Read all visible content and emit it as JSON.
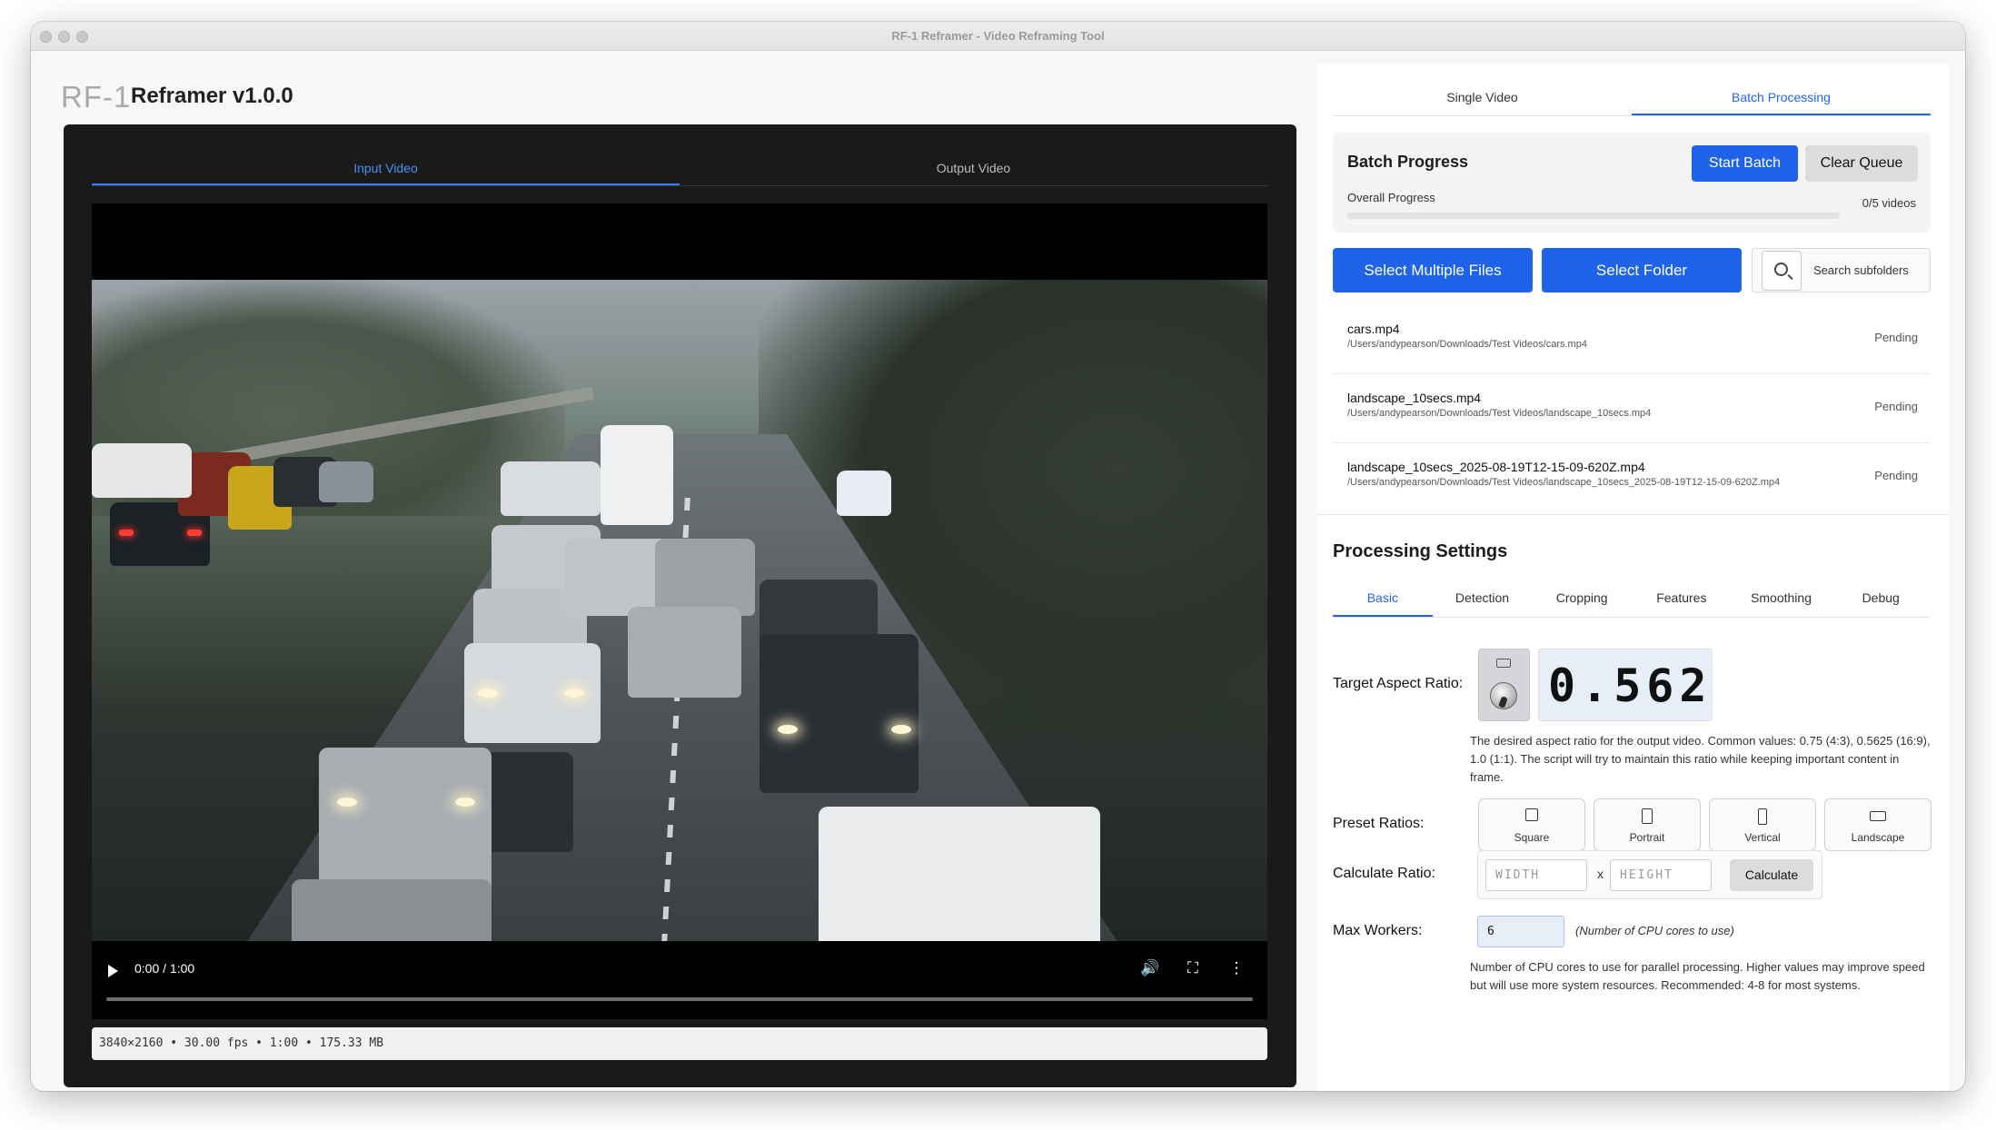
{
  "window": {
    "title": "RF-1 Reframer - Video Reframing Tool"
  },
  "app": {
    "logo": "RF-1",
    "title": "Reframer v1.0.0"
  },
  "video_tabs": [
    {
      "label": "Input Video",
      "active": true
    },
    {
      "label": "Output Video",
      "active": false
    }
  ],
  "player": {
    "time": "0:00 / 1:00",
    "progress": 0,
    "meta": "3840×2160  •  30.00 fps  •  1:00  •  175.33 MB"
  },
  "mode_tabs": [
    {
      "label": "Single Video",
      "active": false
    },
    {
      "label": "Batch Processing",
      "active": true
    }
  ],
  "batch": {
    "title": "Batch Progress",
    "start_label": "Start Batch",
    "clear_label": "Clear Queue",
    "overall_label": "Overall Progress",
    "overall_count": "0/5 videos",
    "overall_progress": 0,
    "select_files_label": "Select Multiple Files",
    "select_folder_label": "Select Folder",
    "search_subfolders_label": "Search subfolders"
  },
  "files": [
    {
      "name": "cars.mp4",
      "path": "/Users/andypearson/Downloads/Test Videos/cars.mp4",
      "status": "Pending"
    },
    {
      "name": "landscape_10secs.mp4",
      "path": "/Users/andypearson/Downloads/Test Videos/landscape_10secs.mp4",
      "status": "Pending"
    },
    {
      "name": "landscape_10secs_2025-08-19T12-15-09-620Z.mp4",
      "path": "/Users/andypearson/Downloads/Test Videos/landscape_10secs_2025-08-19T12-15-09-620Z.mp4",
      "status": "Pending"
    }
  ],
  "settings": {
    "title": "Processing Settings",
    "tabs": [
      {
        "label": "Basic",
        "active": true
      },
      {
        "label": "Detection",
        "active": false
      },
      {
        "label": "Cropping",
        "active": false
      },
      {
        "label": "Features",
        "active": false
      },
      {
        "label": "Smoothing",
        "active": false
      },
      {
        "label": "Debug",
        "active": false
      }
    ],
    "aspect_label": "Target Aspect Ratio:",
    "aspect_value": "0.562",
    "aspect_help": "The desired aspect ratio for the output video. Common values: 0.75 (4:3), 0.5625 (16:9), 1.0 (1:1). The script will try to maintain this ratio while keeping important content in frame.",
    "preset_label": "Preset Ratios:",
    "presets": [
      {
        "label": "Square",
        "icon": "square-icon"
      },
      {
        "label": "Portrait",
        "icon": "portrait-icon"
      },
      {
        "label": "Vertical",
        "icon": "vertical-icon"
      },
      {
        "label": "Landscape",
        "icon": "landscape-icon"
      }
    ],
    "calc_label": "Calculate Ratio:",
    "width_placeholder": "WIDTH",
    "height_placeholder": "HEIGHT",
    "calc_x": "x",
    "calc_button": "Calculate",
    "workers_label": "Max Workers:",
    "workers_value": "6",
    "workers_hint": "(Number of CPU cores to use)",
    "workers_help": "Number of CPU cores to use for parallel processing. Higher values may improve speed but will use more system resources. Recommended: 4-8 for most systems."
  },
  "colors": {
    "accent": "#1f63ea",
    "video_bg": "#1a1a1a"
  }
}
